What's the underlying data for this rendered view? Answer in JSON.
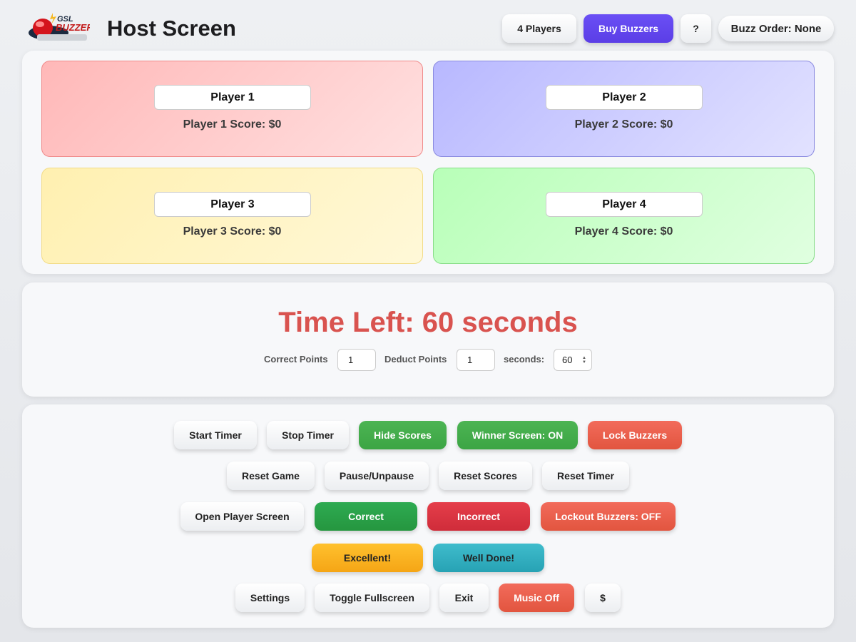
{
  "header": {
    "title": "Host Screen",
    "logo_text": "GSL BUZZER",
    "players_button": "4 Players",
    "buy_button": "Buy Buzzers",
    "help_button": "?",
    "buzz_order": "Buzz Order: None"
  },
  "players": [
    {
      "name": "Player 1",
      "score": "Player 1 Score: $0"
    },
    {
      "name": "Player 2",
      "score": "Player 2 Score: $0"
    },
    {
      "name": "Player 3",
      "score": "Player 3 Score: $0"
    },
    {
      "name": "Player 4",
      "score": "Player 4 Score: $0"
    }
  ],
  "timer": {
    "time_left": "Time Left: 60 seconds",
    "correct_label": "Correct Points",
    "correct_value": "1",
    "deduct_label": "Deduct Points",
    "deduct_value": "1",
    "seconds_label": "seconds:",
    "seconds_value": "60"
  },
  "controls": {
    "start_timer": "Start Timer",
    "stop_timer": "Stop Timer",
    "hide_scores": "Hide Scores",
    "winner_screen": "Winner Screen: ON",
    "lock_buzzers": "Lock Buzzers",
    "reset_game": "Reset Game",
    "pause_unpause": "Pause/Unpause",
    "reset_scores": "Reset Scores",
    "reset_timer": "Reset Timer",
    "open_player_screen": "Open Player Screen",
    "correct": "Correct",
    "incorrect": "Incorrect",
    "lockout_buzzers": "Lockout Buzzers: OFF",
    "excellent": "Excellent!",
    "well_done": "Well Done!",
    "settings": "Settings",
    "toggle_fullscreen": "Toggle Fullscreen",
    "exit": "Exit",
    "music_off": "Music Off",
    "dollar": "$"
  },
  "colors": {
    "accent": "#5b3ee6",
    "timer_text": "#d9534f",
    "correct_green": "#2eab52",
    "incorrect_red": "#cf2c3a"
  }
}
